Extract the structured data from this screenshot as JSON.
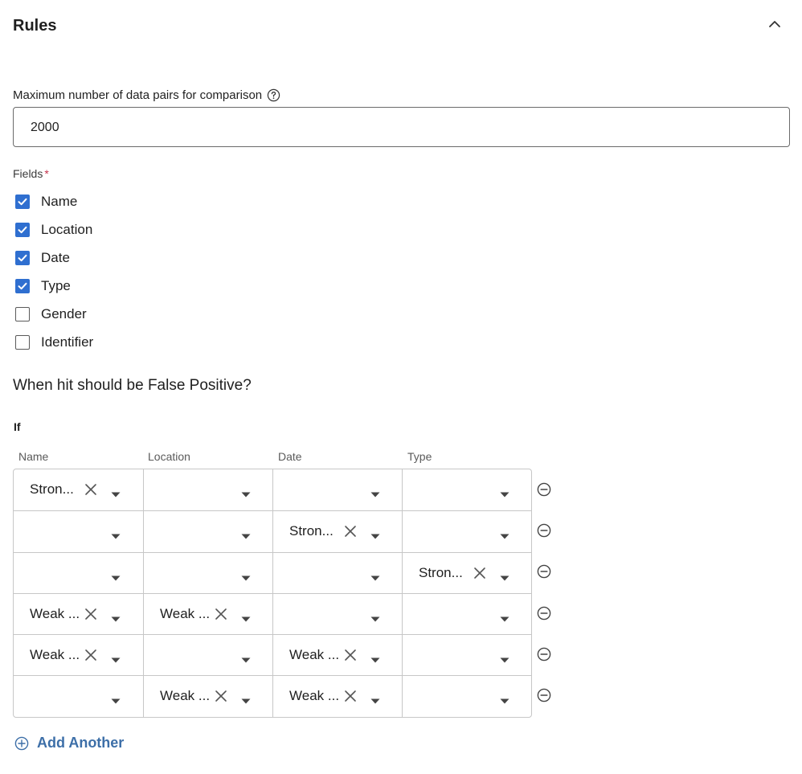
{
  "section": {
    "title": "Rules"
  },
  "max_pairs": {
    "label": "Maximum number of data pairs for comparison",
    "value": "2000"
  },
  "fields": {
    "label": "Fields",
    "required_mark": "*",
    "options": [
      {
        "label": "Name",
        "checked": true
      },
      {
        "label": "Location",
        "checked": true
      },
      {
        "label": "Date",
        "checked": true
      },
      {
        "label": "Type",
        "checked": true
      },
      {
        "label": "Gender",
        "checked": false
      },
      {
        "label": "Identifier",
        "checked": false
      }
    ]
  },
  "question": "When hit should be False Positive?",
  "if_label": "If",
  "rules_table": {
    "columns": [
      "Name",
      "Location",
      "Date",
      "Type"
    ],
    "rows": [
      [
        "Stron...",
        "",
        "",
        ""
      ],
      [
        "",
        "",
        "Stron...",
        ""
      ],
      [
        "",
        "",
        "",
        "Stron..."
      ],
      [
        "Weak ...",
        "Weak ...",
        "",
        ""
      ],
      [
        "Weak ...",
        "",
        "Weak ...",
        ""
      ],
      [
        "",
        "Weak ...",
        "Weak ...",
        ""
      ]
    ]
  },
  "add_another_label": "Add Another",
  "colors": {
    "accent": "#2f6fd0",
    "link": "#3d6fa8",
    "border": "#c7c7c7",
    "required": "#c4314b"
  }
}
